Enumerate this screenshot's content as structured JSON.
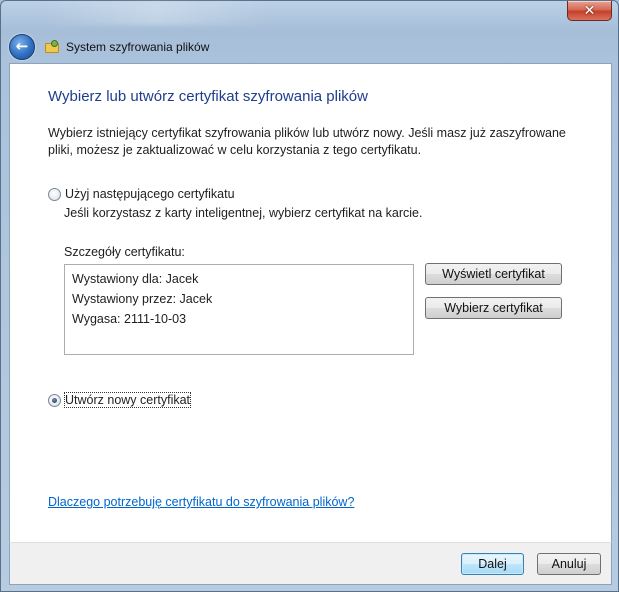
{
  "window": {
    "close_glyph": "✕",
    "nav_title": "System szyfrowania plików",
    "back_glyph": "←"
  },
  "content": {
    "heading": "Wybierz lub utwórz certyfikat szyfrowania plików",
    "intro": "Wybierz istniejący certyfikat szyfrowania plików lub utwórz nowy. Jeśli masz już zaszyfrowane pliki, możesz je zaktualizować w celu korzystania z tego certyfikatu.",
    "option_existing_label": "Użyj następującego certyfikatu",
    "option_existing_note": "Jeśli korzystasz z karty inteligentnej, wybierz certyfikat na karcie.",
    "details_label": "Szczegóły certyfikatu:",
    "details": {
      "issued_to": "Wystawiony dla: Jacek",
      "issued_by": "Wystawiony przez: Jacek",
      "expires": "Wygasa: 2111-10-03"
    },
    "view_cert_button": "Wyświetl certyfikat",
    "select_cert_button": "Wybierz certyfikat",
    "option_new_label": "Utwórz nowy certyfikat",
    "selected_option": "new",
    "help_link": "Dlaczego potrzebuję certyfikatu do szyfrowania plików?"
  },
  "footer": {
    "next_button": "Dalej",
    "cancel_button": "Anuluj"
  },
  "icons": {
    "back": "back-arrow-icon",
    "app": "folder-key-icon",
    "close": "close-icon"
  }
}
